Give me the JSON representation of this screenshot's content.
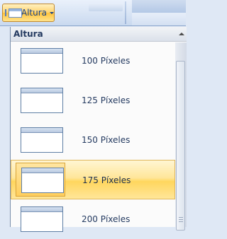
{
  "ribbon": {
    "dropdown_label": "Altura"
  },
  "menu": {
    "title": "Altura",
    "items": [
      {
        "label": "100 Píxeles",
        "selected": false
      },
      {
        "label": "125 Píxeles",
        "selected": false
      },
      {
        "label": "150 Píxeles",
        "selected": false
      },
      {
        "label": "175 Píxeles",
        "selected": true
      },
      {
        "label": "200 Píxeles",
        "selected": false
      }
    ]
  },
  "colors": {
    "accent": "#ffd36c",
    "text": "#15428b"
  }
}
